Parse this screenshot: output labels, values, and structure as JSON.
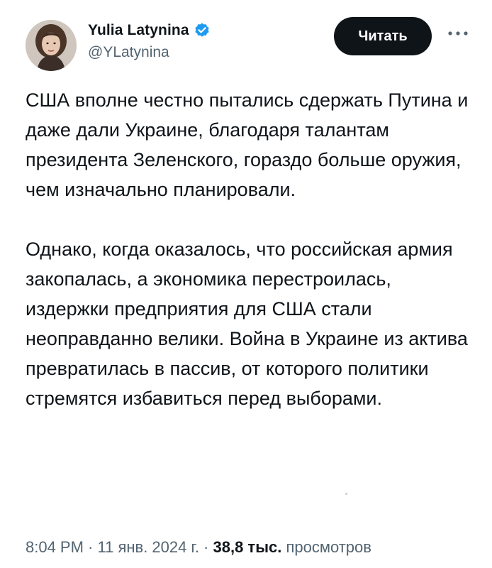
{
  "author": {
    "display_name": "Yulia Latynina",
    "handle": "@YLatynina",
    "verified": true,
    "verified_color": "#1d9bf0"
  },
  "actions": {
    "read_label": "Читать",
    "more_icon": "ellipsis-icon"
  },
  "tweet": {
    "paragraphs": [
      "США вполне честно пытались сдержать Путина и даже дали Украине, благодаря талантам президента Зеленского, гораздо больше оружия, чем изначально планировали.",
      "Однако, когда оказалось, что российская армия закопалась, а экономика перестроилась, издержки предприятия для США стали неоправданно велики. Война в Украине из актива превратилась в пассив, от которого политики стремятся избавиться перед выборами."
    ]
  },
  "meta": {
    "time": "8:04 PM",
    "separator": " · ",
    "date": "11 янв. 2024 г.",
    "views_count": "38,8 тыс.",
    "views_label": "просмотров"
  },
  "colors": {
    "text": "#0f1419",
    "secondary": "#536471",
    "button_bg": "#0f1419"
  }
}
